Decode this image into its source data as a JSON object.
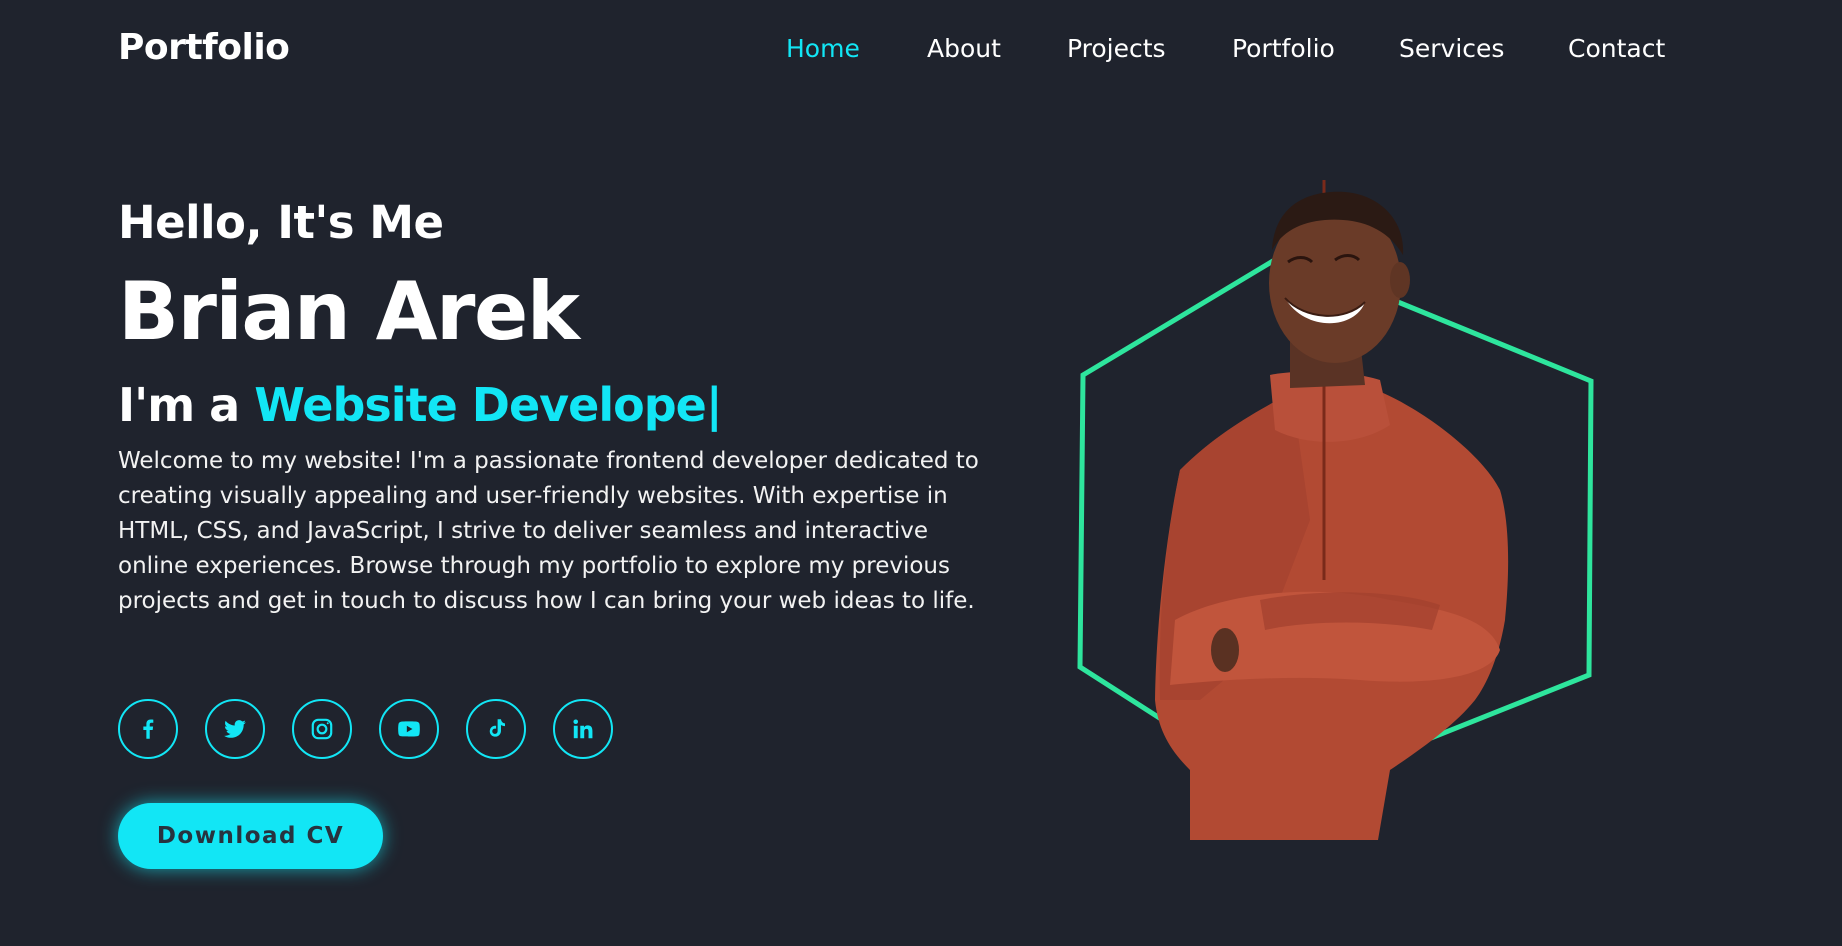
{
  "header": {
    "logo": "Portfolio",
    "nav": [
      {
        "label": "Home",
        "active": true
      },
      {
        "label": "About",
        "active": false
      },
      {
        "label": "Projects",
        "active": false
      },
      {
        "label": "Portfolio",
        "active": false
      },
      {
        "label": "Services",
        "active": false
      },
      {
        "label": "Contact",
        "active": false
      }
    ]
  },
  "hero": {
    "greeting": "Hello, It's Me",
    "name": "Brian Arek",
    "role_prefix": "I'm a ",
    "role_typed": "Website Develope|",
    "description": "Welcome to my website! I'm a passionate frontend developer dedicated to creating visually appealing and user-friendly websites. With expertise in HTML, CSS, and JavaScript, I strive to deliver seamless and interactive online experiences. Browse through my portfolio to explore my previous projects and get in touch to discuss how I can bring your web ideas to life.",
    "socials": [
      "facebook-icon",
      "twitter-icon",
      "instagram-icon",
      "youtube-icon",
      "tiktok-icon",
      "linkedin-icon"
    ],
    "cta_label": "Download CV"
  },
  "theme": {
    "background": "#1f232d",
    "accent": "#12e6f5",
    "hexagon": "#2ee59d",
    "text": "#ffffff"
  }
}
